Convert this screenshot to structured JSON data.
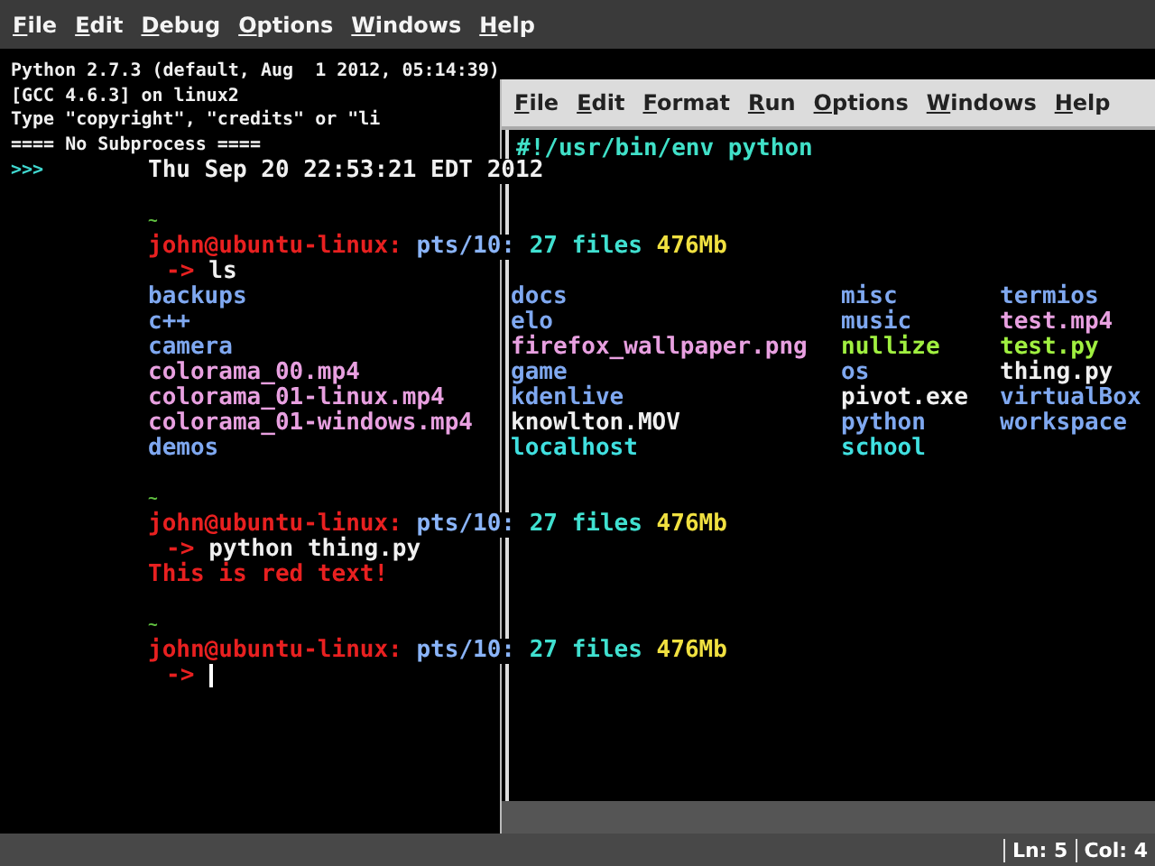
{
  "shell": {
    "menu": [
      "File",
      "Edit",
      "Debug",
      "Options",
      "Windows",
      "Help"
    ],
    "banner": [
      "Python 2.7.3 (default, Aug  1 2012, 05:14:39)",
      "[GCC 4.6.3] on linux2",
      "Type \"copyright\", \"credits\" or \"li",
      "==== No Subprocess ===="
    ],
    "prompt": ">>>",
    "status": {
      "line": "Ln: 5",
      "column": "Col: 4"
    }
  },
  "editor": {
    "menu": [
      "File",
      "Edit",
      "Format",
      "Run",
      "Options",
      "Windows",
      "Help"
    ],
    "code": [
      "#!/usr/bin/env python"
    ]
  },
  "terminal": {
    "date": "Thu Sep 20 22:53:21 EDT 2012",
    "sessions": [
      {
        "tilde": "~",
        "user": "john@ubuntu-linux:",
        "tty": "pts/10:",
        "files": "27 files",
        "size": "476Mb",
        "arrow": "->",
        "command": "ls",
        "listing": [
          [
            {
              "name": "backups",
              "color": "#7fa8f0"
            },
            {
              "name": "c++",
              "color": "#7fa8f0"
            },
            {
              "name": "camera",
              "color": "#7fa8f0"
            },
            {
              "name": "colorama_00.mp4",
              "color": "#e8a0e0"
            },
            {
              "name": "colorama_01-linux.mp4",
              "color": "#e8a0e0"
            },
            {
              "name": "colorama_01-windows.mp4",
              "color": "#e8a0e0"
            },
            {
              "name": "demos",
              "color": "#7fa8f0"
            }
          ],
          [
            {
              "name": "docs",
              "color": "#7fa8f0"
            },
            {
              "name": "elo",
              "color": "#7fa8f0"
            },
            {
              "name": "firefox_wallpaper.png",
              "color": "#e8a0e0"
            },
            {
              "name": "game",
              "color": "#7fa8f0"
            },
            {
              "name": "kdenlive",
              "color": "#7fa8f0"
            },
            {
              "name": "knowlton.MOV",
              "color": "#f0f0f0"
            },
            {
              "name": "localhost",
              "color": "#40e0e0"
            }
          ],
          [
            {
              "name": "misc",
              "color": "#7fa8f0"
            },
            {
              "name": "music",
              "color": "#7fa8f0"
            },
            {
              "name": "nullize",
              "color": "#a0f040"
            },
            {
              "name": "os",
              "color": "#7fa8f0"
            },
            {
              "name": "pivot.exe",
              "color": "#f0f0f0"
            },
            {
              "name": "python",
              "color": "#7fa8f0"
            },
            {
              "name": "school",
              "color": "#40e0e0"
            }
          ],
          [
            {
              "name": "termios",
              "color": "#7fa8f0"
            },
            {
              "name": "test.mp4",
              "color": "#e8a0e0"
            },
            {
              "name": "test.py",
              "color": "#a0f040"
            },
            {
              "name": "thing.py",
              "color": "#f0f0f0"
            },
            {
              "name": "virtualBox",
              "color": "#7fa8f0"
            },
            {
              "name": "workspace",
              "color": "#7fa8f0"
            }
          ]
        ]
      },
      {
        "tilde": "~",
        "user": "john@ubuntu-linux:",
        "tty": "pts/10:",
        "files": "27 files",
        "size": "476Mb",
        "arrow": "->",
        "command": "python thing.py",
        "output": "This is red text!"
      },
      {
        "tilde": "~",
        "user": "john@ubuntu-linux:",
        "tty": "pts/10:",
        "files": "27 files",
        "size": "476Mb",
        "arrow": "->",
        "cursor": true
      }
    ]
  }
}
